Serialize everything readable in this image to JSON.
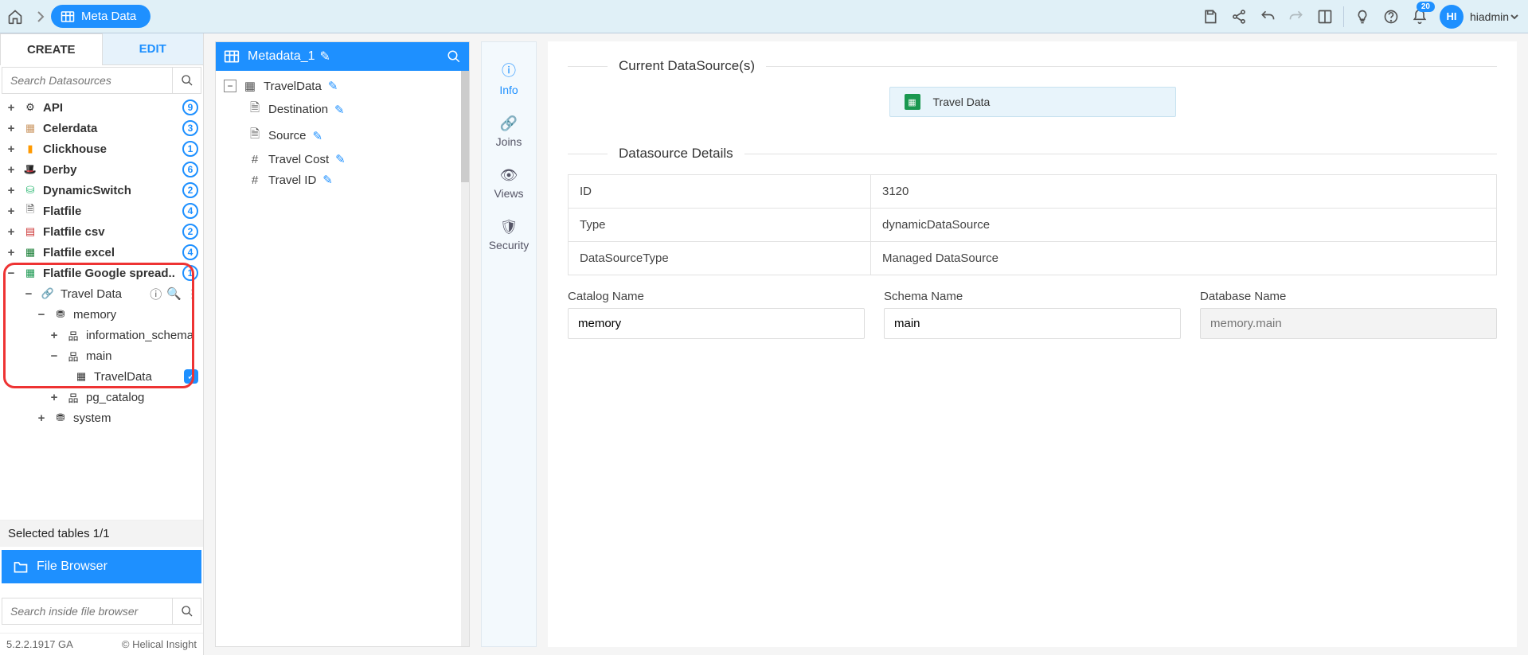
{
  "breadcrumb": {
    "label": "Meta Data"
  },
  "topbar": {
    "notif_count": "20",
    "avatar_initials": "HI",
    "username": "hiadmin"
  },
  "left": {
    "tabs": {
      "create": "CREATE",
      "edit": "EDIT"
    },
    "search_ph": "Search Datasources",
    "items": [
      {
        "label": "API",
        "count": "9"
      },
      {
        "label": "Celerdata",
        "count": "3"
      },
      {
        "label": "Clickhouse",
        "count": "1"
      },
      {
        "label": "Derby",
        "count": "6"
      },
      {
        "label": "DynamicSwitch",
        "count": "2"
      },
      {
        "label": "Flatfile",
        "count": "4"
      },
      {
        "label": "Flatfile csv",
        "count": "2"
      },
      {
        "label": "Flatfile excel",
        "count": "4"
      },
      {
        "label": "Flatfile Google spread..",
        "count": "1"
      }
    ],
    "travel_data": "Travel Data",
    "memory": "memory",
    "info_schema": "information_schema",
    "main": "main",
    "travel_table": "TravelData",
    "pg_catalog": "pg_catalog",
    "system": "system",
    "selected_tables": "Selected tables 1/1",
    "file_browser": "File Browser",
    "fb_search_ph": "Search inside file browser",
    "version": "5.2.2.1917 GA",
    "copyright": "Helical Insight"
  },
  "middle": {
    "title": "Metadata_1",
    "root": "TravelData",
    "fields": [
      {
        "label": "Destination",
        "icon": "doc"
      },
      {
        "label": "Source",
        "icon": "doc"
      },
      {
        "label": "Travel Cost",
        "icon": "hash"
      },
      {
        "label": "Travel ID",
        "icon": "hash"
      }
    ]
  },
  "vnav": {
    "info": "Info",
    "joins": "Joins",
    "views": "Views",
    "security": "Security"
  },
  "detail": {
    "legend1": "Current DataSource(s)",
    "chip_label": "Travel Data",
    "legend2": "Datasource Details",
    "rows": [
      {
        "k": "ID",
        "v": "3120"
      },
      {
        "k": "Type",
        "v": "dynamicDataSource"
      },
      {
        "k": "DataSourceType",
        "v": "Managed DataSource"
      }
    ],
    "form": {
      "catalog_label": "Catalog Name",
      "catalog_value": "memory",
      "schema_label": "Schema Name",
      "schema_value": "main",
      "db_label": "Database Name",
      "db_ph": "memory.main"
    }
  }
}
